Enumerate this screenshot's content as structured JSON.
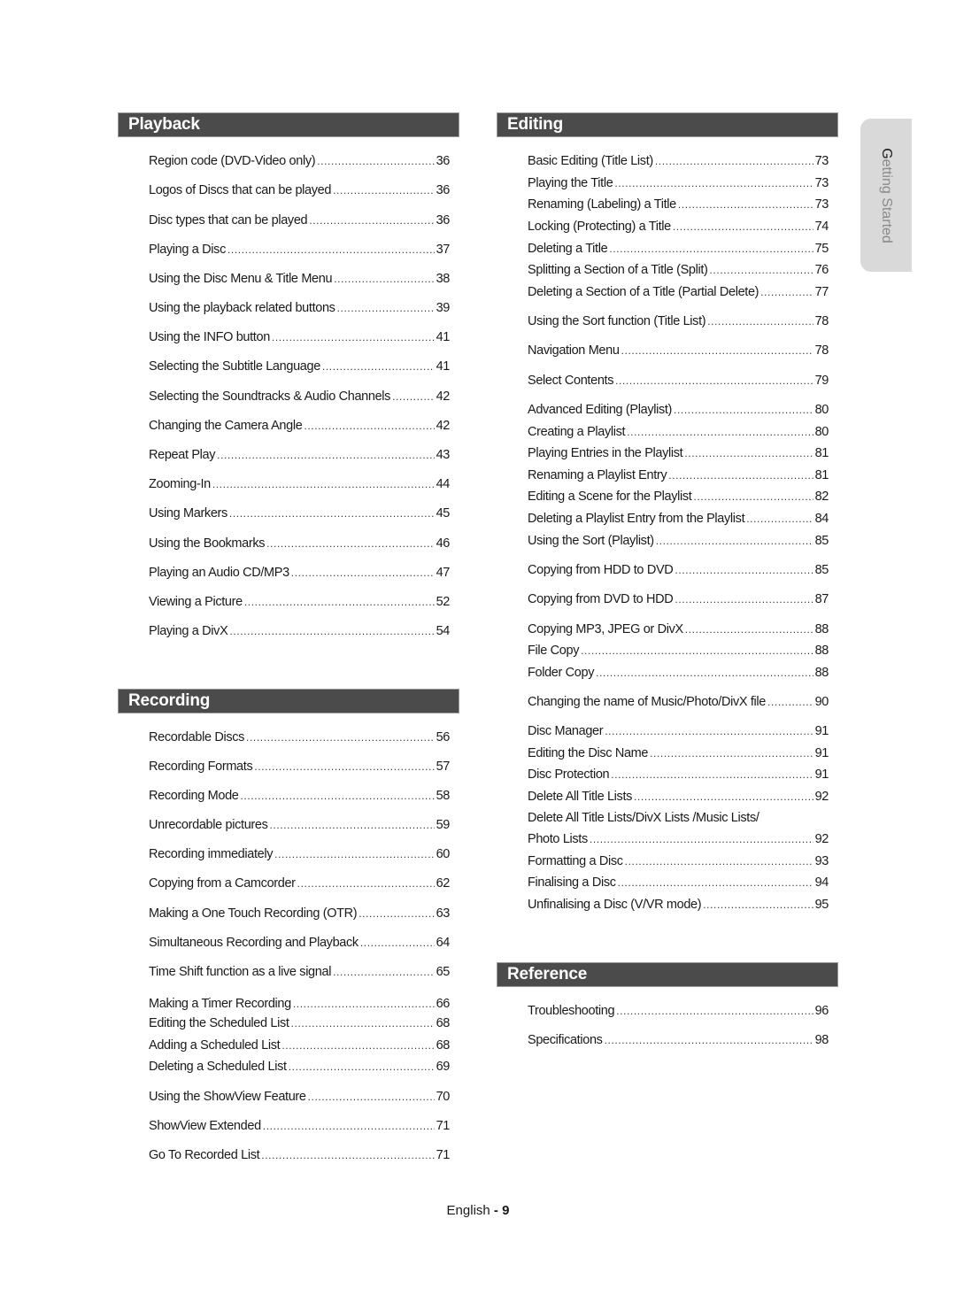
{
  "side_tab": {
    "first_letter": "G",
    "rest": "etting Started"
  },
  "footer": {
    "language": "English",
    "separator": "-",
    "page_number": "9"
  },
  "sections": {
    "playback": {
      "title": "Playback",
      "entries": [
        {
          "title": "Region code (DVD-Video only)",
          "page": "36"
        },
        {
          "title": "Logos of Discs that can be played",
          "page": "36"
        },
        {
          "title": "Disc types that can be played",
          "page": "36"
        },
        {
          "title": "Playing a Disc",
          "page": "37"
        },
        {
          "title": "Using the Disc Menu & Title Menu",
          "page": "38"
        },
        {
          "title": "Using the playback related buttons",
          "page": "39"
        },
        {
          "title": "Using the INFO button",
          "page": "41"
        },
        {
          "title": "Selecting the Subtitle Language",
          "page": "41"
        },
        {
          "title": "Selecting the Soundtracks & Audio Channels",
          "page": "42"
        },
        {
          "title": "Changing the Camera Angle",
          "page": "42"
        },
        {
          "title": "Repeat Play",
          "page": "43"
        },
        {
          "title": "Zooming-In",
          "page": "44"
        },
        {
          "title": "Using Markers",
          "page": "45"
        },
        {
          "title": "Using the Bookmarks",
          "page": "46"
        },
        {
          "title": "Playing an Audio CD/MP3",
          "page": "47"
        },
        {
          "title": "Viewing a Picture",
          "page": "52"
        },
        {
          "title": "Playing a DivX",
          "page": "54"
        }
      ]
    },
    "recording": {
      "title": "Recording",
      "entries": [
        {
          "title": "Recordable Discs",
          "page": "56"
        },
        {
          "title": "Recording Formats",
          "page": "57"
        },
        {
          "title": "Recording Mode",
          "page": "58"
        },
        {
          "title": "Unrecordable pictures",
          "page": "59"
        },
        {
          "title": "Recording immediately",
          "page": "60"
        },
        {
          "title": "Copying from a Camcorder",
          "page": "62"
        },
        {
          "title": "Making a One Touch Recording (OTR)",
          "page": "63"
        },
        {
          "title": "Simultaneous Recording and Playback",
          "page": "64"
        },
        {
          "title": "Time Shift function as a live signal",
          "page": "65"
        },
        {
          "title": "Making a Timer Recording",
          "page": "66"
        },
        {
          "title": "Editing the Scheduled List",
          "page": "68"
        },
        {
          "title": "Adding a Scheduled List",
          "page": "68"
        },
        {
          "title": "Deleting a Scheduled List",
          "page": "69"
        },
        {
          "title": "Using the ShowView Feature",
          "page": "70"
        },
        {
          "title": "ShowView Extended",
          "page": "71"
        },
        {
          "title": "Go To Recorded List",
          "page": "71"
        }
      ]
    },
    "editing": {
      "title": "Editing",
      "entries": [
        {
          "title": "Basic Editing (Title List)",
          "page": "73"
        },
        {
          "title": "Playing the Title",
          "page": "73"
        },
        {
          "title": "Renaming (Labeling) a Title",
          "page": "73"
        },
        {
          "title": "Locking (Protecting) a Title",
          "page": "74"
        },
        {
          "title": "Deleting a Title",
          "page": "75"
        },
        {
          "title": "Splitting a Section of a Title (Split)",
          "page": "76"
        },
        {
          "title": "Deleting a Section of a Title (Partial Delete)",
          "page": "77"
        },
        {
          "title": "Using the Sort function (Title List)",
          "page": "78"
        },
        {
          "title": "Navigation Menu",
          "page": "78"
        },
        {
          "title": "Select Contents",
          "page": "79"
        },
        {
          "title": "Advanced Editing (Playlist)",
          "page": "80"
        },
        {
          "title": "Creating a Playlist",
          "page": "80"
        },
        {
          "title": "Playing Entries in the Playlist",
          "page": "81"
        },
        {
          "title": "Renaming a Playlist Entry",
          "page": "81"
        },
        {
          "title": "Editing a Scene for the Playlist",
          "page": "82"
        },
        {
          "title": "Deleting a Playlist Entry from the Playlist",
          "page": "84"
        },
        {
          "title": "Using the Sort (Playlist)",
          "page": "85"
        },
        {
          "title": "Copying from HDD to DVD",
          "page": "85"
        },
        {
          "title": "Copying from DVD to HDD",
          "page": "87"
        },
        {
          "title": "Copying MP3, JPEG or DivX",
          "page": "88"
        },
        {
          "title": "File Copy",
          "page": "88"
        },
        {
          "title": "Folder Copy",
          "page": "88"
        },
        {
          "title": "Changing the name of Music/Photo/DivX file",
          "page": "90"
        },
        {
          "title": "Disc Manager",
          "page": "91"
        },
        {
          "title": "Editing the Disc Name",
          "page": "91"
        },
        {
          "title": "Disc Protection",
          "page": "91"
        },
        {
          "title": "Delete All Title Lists",
          "page": "92"
        },
        {
          "title": "Delete All Title Lists/DivX Lists /Music Lists/",
          "page": ""
        },
        {
          "title": "Photo Lists",
          "page": "92"
        },
        {
          "title": "Formatting a Disc",
          "page": "93"
        },
        {
          "title": "Finalising a Disc",
          "page": "94"
        },
        {
          "title": "Unfinalising a Disc (V/VR mode)",
          "page": "95"
        }
      ]
    },
    "reference": {
      "title": "Reference",
      "entries": [
        {
          "title": "Troubleshooting",
          "page": "96"
        },
        {
          "title": "Specifications",
          "page": "98"
        }
      ]
    }
  }
}
